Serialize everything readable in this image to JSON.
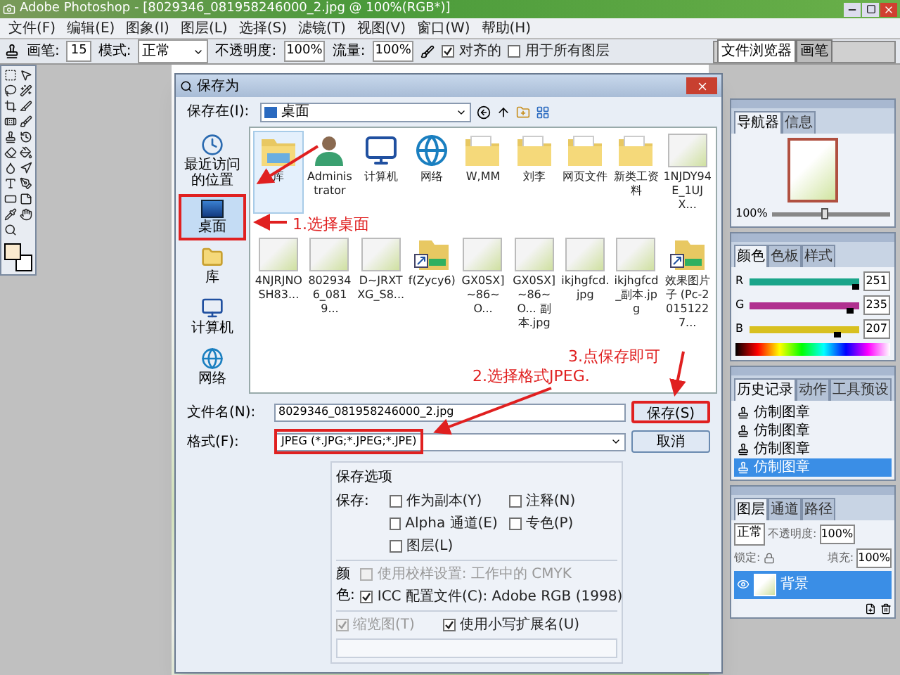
{
  "window": {
    "title": "Adobe Photoshop - [8029346_081958246000_2.jpg @ 100%(RGB*)]"
  },
  "menu": [
    {
      "label": "文件(F)"
    },
    {
      "label": "编辑(E)"
    },
    {
      "label": "图象(I)"
    },
    {
      "label": "图层(L)"
    },
    {
      "label": "选择(S)"
    },
    {
      "label": "滤镜(T)"
    },
    {
      "label": "视图(V)"
    },
    {
      "label": "窗口(W)"
    },
    {
      "label": "帮助(H)"
    }
  ],
  "options_bar": {
    "brush_label": "画笔:",
    "brush_size": "15",
    "mode_label": "模式:",
    "mode": "正常",
    "opacity_label": "不透明度:",
    "opacity": "100%",
    "flow_label": "流量:",
    "flow": "100%",
    "aligned": {
      "label": "对齐的",
      "checked": true
    },
    "all_layers": {
      "label": "用于所有图层",
      "checked": false
    }
  },
  "palette_well": [
    {
      "label": "文件浏览器",
      "selected": true
    },
    {
      "label": "画笔",
      "selected": false
    }
  ],
  "save_dialog": {
    "title": "保存为",
    "save_in_label": "保存在(I):",
    "save_in": "桌面",
    "places": [
      {
        "label": "最近访问的位置",
        "kind": "recent",
        "selected": false,
        "highlighted": false
      },
      {
        "label": "桌面",
        "kind": "desktop",
        "selected": true,
        "highlighted": true
      },
      {
        "label": "库",
        "kind": "library",
        "selected": false,
        "highlighted": false
      },
      {
        "label": "计算机",
        "kind": "computer",
        "selected": false,
        "highlighted": false
      },
      {
        "label": "网络",
        "kind": "network",
        "selected": false,
        "highlighted": false
      }
    ],
    "files": [
      {
        "name": "库",
        "kind": "library",
        "selected": true
      },
      {
        "name": "Administrator",
        "kind": "user",
        "selected": false
      },
      {
        "name": "计算机",
        "kind": "computer",
        "selected": false
      },
      {
        "name": "网络",
        "kind": "network",
        "selected": false
      },
      {
        "name": "W,MM",
        "kind": "folder",
        "selected": false
      },
      {
        "name": "刘李",
        "kind": "folder",
        "selected": false
      },
      {
        "name": "网页文件",
        "kind": "folder",
        "selected": false
      },
      {
        "name": "新类工资料",
        "kind": "folder",
        "selected": false
      },
      {
        "name": "1NJDY94E_1UJX...",
        "kind": "image",
        "selected": false
      },
      {
        "name": "4NJRJNOSH83...",
        "kind": "image",
        "selected": false
      },
      {
        "name": "8029346_0819...",
        "kind": "image",
        "selected": false
      },
      {
        "name": "D~JRXTXG_S8...",
        "kind": "image",
        "selected": false
      },
      {
        "name": "f(Zycy6)",
        "kind": "shortcut",
        "selected": false
      },
      {
        "name": "GX0SX]~86~O...",
        "kind": "image",
        "selected": false
      },
      {
        "name": "GX0SX]~86~O... 副本.jpg",
        "kind": "image",
        "selected": false
      },
      {
        "name": "ikjhgfcd.jpg",
        "kind": "image",
        "selected": false
      },
      {
        "name": "ikjhgfcd_副本.jpg",
        "kind": "image",
        "selected": false
      },
      {
        "name": "效果图片子 (Pc-20151227...",
        "kind": "shortcut",
        "selected": false
      }
    ],
    "filename_label": "文件名(N):",
    "filename": "8029346_081958246000_2.jpg",
    "format_label": "格式(F):",
    "format": "JPEG (*.JPG;*.JPEG;*.JPE)",
    "format_highlighted": true,
    "buttons": [
      {
        "label": "保存(S)",
        "highlighted": true
      },
      {
        "label": "取消",
        "highlighted": false
      }
    ],
    "options": {
      "title": "保存选项",
      "save_label": "保存:",
      "save_checks": [
        {
          "label": "作为副本(Y)",
          "checked": false,
          "disabled": false
        },
        {
          "label": "注释(N)",
          "checked": false,
          "disabled": false
        },
        {
          "label": "Alpha 通道(E)",
          "checked": false,
          "disabled": false
        },
        {
          "label": "专色(P)",
          "checked": false,
          "disabled": false
        },
        {
          "label": "图层(L)",
          "checked": false,
          "disabled": false
        }
      ],
      "color_label": "颜色:",
      "color_checks": [
        {
          "label": "使用校样设置: 工作中的 CMYK",
          "checked": false,
          "disabled": true
        },
        {
          "label": "ICC 配置文件(C): Adobe RGB (1998)",
          "checked": true,
          "disabled": false
        }
      ],
      "bottom_checks": [
        {
          "label": "缩览图(T)",
          "checked": true,
          "disabled": true
        },
        {
          "label": "使用小写扩展名(U)",
          "checked": true,
          "disabled": false
        }
      ]
    }
  },
  "annotations": [
    {
      "text": "1.选择桌面"
    },
    {
      "text": "2.选择格式JPEG."
    },
    {
      "text": "3.点保存即可"
    }
  ],
  "panels": [
    {
      "kind": "navigator",
      "tabs": [
        {
          "label": "导航器",
          "selected": true
        },
        {
          "label": "信息",
          "selected": false
        }
      ],
      "zoom": "100%",
      "level": 0.45
    },
    {
      "kind": "color",
      "tabs": [
        {
          "label": "颜色",
          "selected": true
        },
        {
          "label": "色板",
          "selected": false
        },
        {
          "label": "样式",
          "selected": false
        }
      ],
      "channels": [
        {
          "name": "R",
          "value": "251",
          "level": 0.98,
          "color": "#1aa58a"
        },
        {
          "name": "G",
          "value": "235",
          "level": 0.92,
          "color": "#b0308f"
        },
        {
          "name": "B",
          "value": "207",
          "level": 0.81,
          "color": "#d8c020"
        }
      ]
    },
    {
      "kind": "history",
      "tabs": [
        {
          "label": "历史记录",
          "selected": true
        },
        {
          "label": "动作",
          "selected": false
        },
        {
          "label": "工具预设",
          "selected": false
        }
      ],
      "items": [
        {
          "label": "仿制图章",
          "selected": false
        },
        {
          "label": "仿制图章",
          "selected": false
        },
        {
          "label": "仿制图章",
          "selected": false
        },
        {
          "label": "仿制图章",
          "selected": true
        }
      ]
    },
    {
      "kind": "layers",
      "tabs": [
        {
          "label": "图层",
          "selected": true
        },
        {
          "label": "通道",
          "selected": false
        },
        {
          "label": "路径",
          "selected": false
        }
      ],
      "blend_mode": "正常",
      "opacity_label": "不透明度:",
      "opacity": "100%",
      "lock_label": "锁定:",
      "fill_label": "填充:",
      "fill": "100%",
      "layers": [
        {
          "name": "背景",
          "selected": true,
          "visible": true
        }
      ]
    }
  ]
}
